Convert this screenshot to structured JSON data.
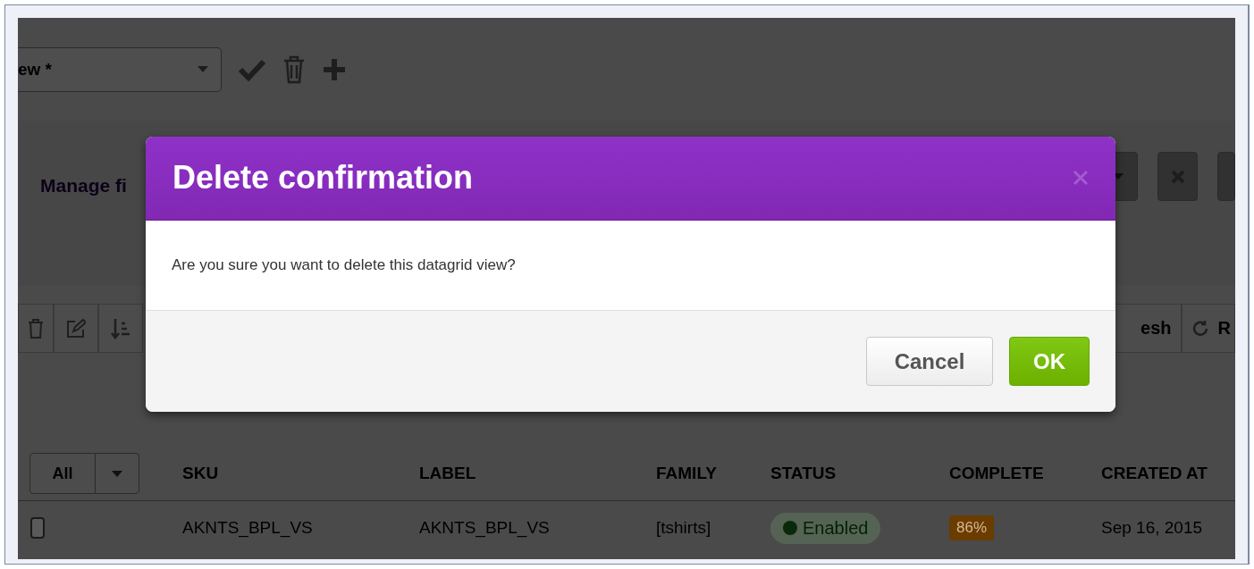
{
  "view_selector": {
    "value": "ew *"
  },
  "filters": {
    "manage_label": "Manage fi"
  },
  "toolbar": {
    "right_labels": [
      "esh",
      "R"
    ]
  },
  "grid": {
    "select_all": "All",
    "columns": [
      "SKU",
      "LABEL",
      "FAMILY",
      "STATUS",
      "COMPLETE",
      "CREATED AT"
    ],
    "rows": [
      {
        "checked": false,
        "sku": "AKNTS_BPL_VS",
        "label": "AKNTS_BPL_VS",
        "family": "[tshirts]",
        "status": {
          "label": "Enabled",
          "enabled": true
        },
        "complete": "86%",
        "created_at": "Sep 16, 2015"
      }
    ]
  },
  "dialog": {
    "title": "Delete confirmation",
    "message": "Are you sure you want to delete this datagrid view?",
    "buttons": [
      {
        "label": "Cancel",
        "kind": "default"
      },
      {
        "label": "OK",
        "kind": "primary"
      }
    ]
  }
}
